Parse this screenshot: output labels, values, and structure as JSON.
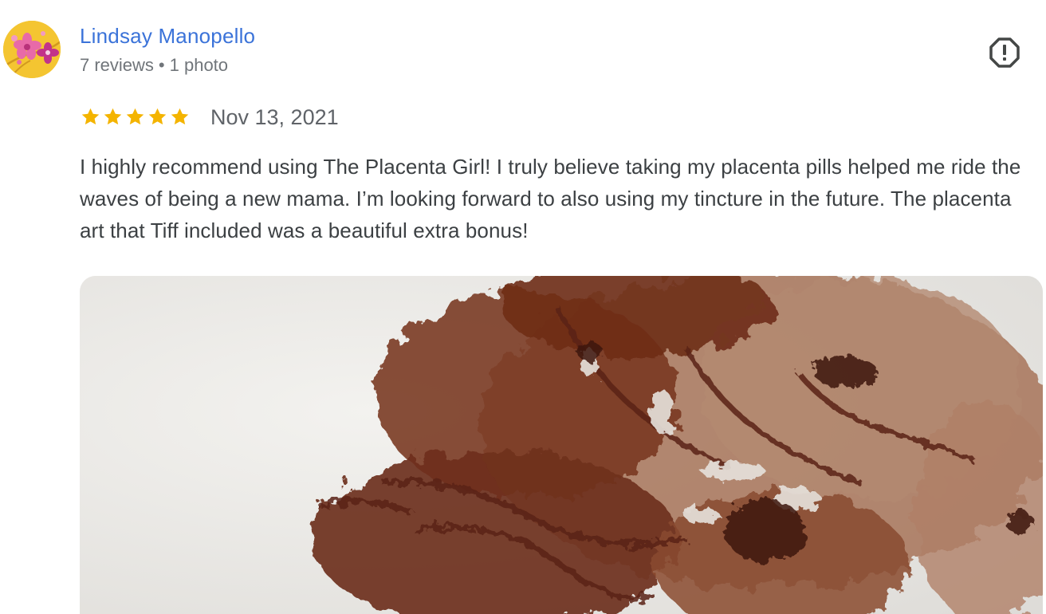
{
  "reviewer": {
    "name": "Lindsay Manopello",
    "reviews_count": "7 reviews",
    "separator": "•",
    "photos_count": "1 photo",
    "avatar_icon": "cherry-blossom-avatar"
  },
  "review": {
    "rating": 5,
    "rating_max": 5,
    "date": "Nov 13, 2021",
    "text": "I highly recommend using The Placenta Girl! I truly believe taking my placenta pills helped me ride the waves of being a new mama. I’m looking forward to also using my tincture in the future. The placenta art that Tiff included was a beautiful extra bonus!",
    "photo_subject": "placenta-art-print"
  },
  "actions": {
    "flag_icon": "report-flag-icon"
  },
  "colors": {
    "name_link": "#3b73d9",
    "star": "#f4b400",
    "meta_text": "#70757a",
    "body_text": "#3c4043",
    "avatar_bg": "#f4c531",
    "art_ink": "#7a3420"
  }
}
